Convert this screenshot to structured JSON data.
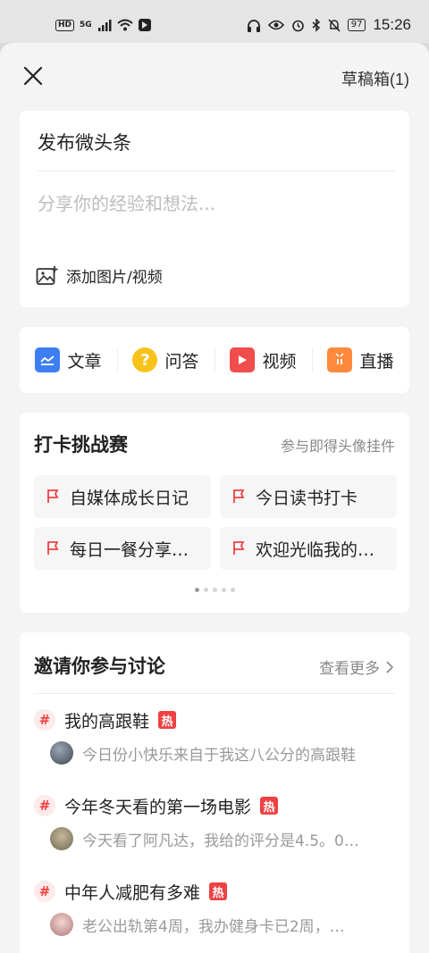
{
  "status_bar": {
    "left_badges": [
      "HD",
      "5G"
    ],
    "battery": "97",
    "time": "15:26"
  },
  "header": {
    "close_icon": "close-icon",
    "drafts_label": "草稿箱(1)"
  },
  "composer": {
    "title": "发布微头条",
    "placeholder": "分享你的经验和想法...",
    "add_media_label": "添加图片/视频"
  },
  "post_types": [
    {
      "label": "文章",
      "icon": "article-icon",
      "color": "#3d7ff3"
    },
    {
      "label": "问答",
      "icon": "question-icon",
      "color": "#f7c21a"
    },
    {
      "label": "视频",
      "icon": "video-icon",
      "color": "#f04d4d"
    },
    {
      "label": "直播",
      "icon": "live-icon",
      "color": "#ff8a3d"
    }
  ],
  "checkin": {
    "title": "打卡挑战赛",
    "subtitle": "参与即得头像挂件",
    "chips": [
      "自媒体成长日记",
      "今日读书打卡",
      "每日一餐分享…",
      "欢迎光临我的…"
    ],
    "page_count": 5,
    "active_page": 1
  },
  "discussion": {
    "title": "邀请你参与讨论",
    "more_label": "查看更多",
    "hot_badge": "热",
    "topics": [
      {
        "title": "我的高跟鞋",
        "snippet": "今日份小快乐来自于我这八公分的高跟鞋"
      },
      {
        "title": "今年冬天看的第一场电影",
        "snippet": "今天看了阿凡达，我给的评分是4.5。0…"
      },
      {
        "title": "中年人减肥有多难",
        "snippet": "老公出轨第4周，我办健身卡已2周，…"
      }
    ]
  },
  "colors": {
    "accent_red": "#f04142",
    "background": "#f4f4f4"
  }
}
